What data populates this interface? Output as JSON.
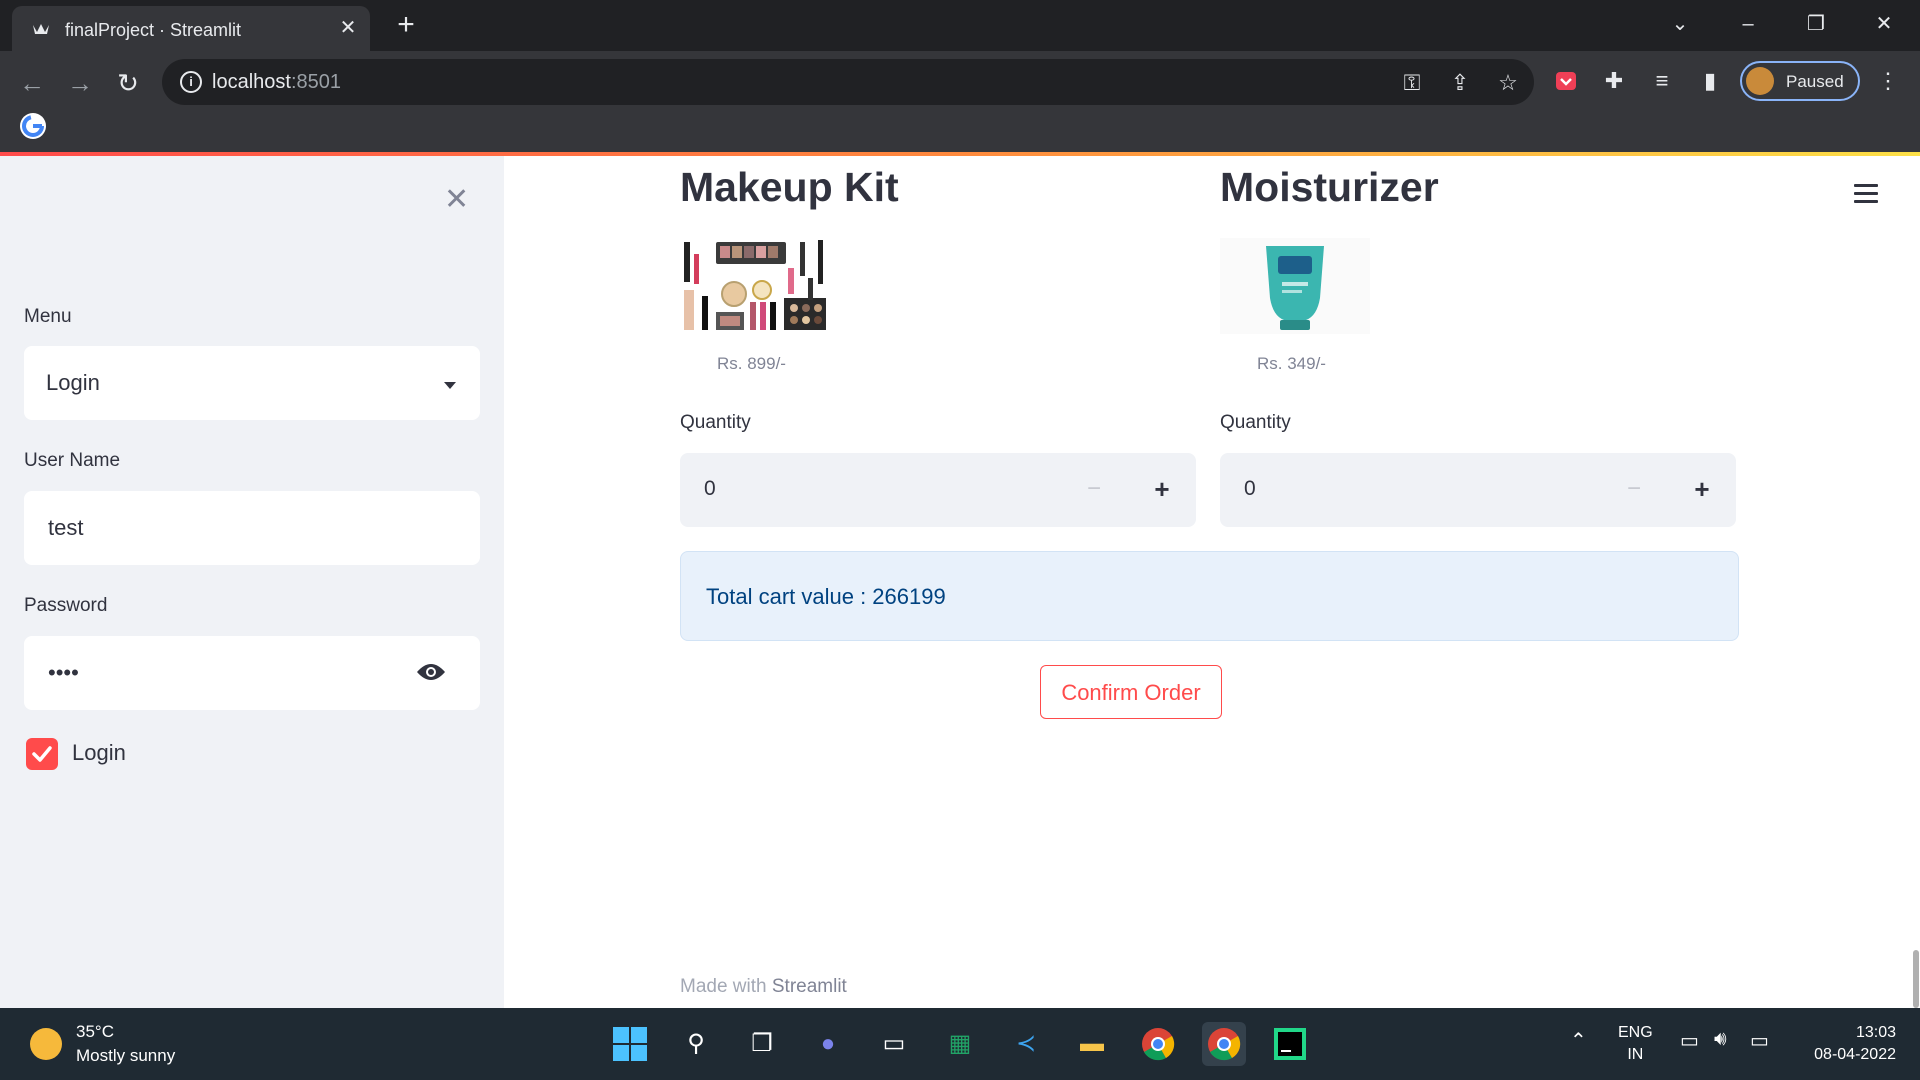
{
  "browser": {
    "tab_title": "finalProject · Streamlit",
    "url_host": "localhost",
    "url_port": ":8501",
    "profile_status": "Paused"
  },
  "sidebar": {
    "menu_label": "Menu",
    "menu_value": "Login",
    "username_label": "User Name",
    "username_value": "test",
    "password_label": "Password",
    "password_value": "••••",
    "login_checkbox_label": "Login",
    "login_checked": true
  },
  "products": [
    {
      "name": "Makeup Kit",
      "price": "Rs. 899/-",
      "quantity_label": "Quantity",
      "quantity": "0"
    },
    {
      "name": "Moisturizer",
      "price": "Rs. 349/-",
      "quantity_label": "Quantity",
      "quantity": "0"
    }
  ],
  "cart": {
    "total_text": "Total cart value : 266199"
  },
  "confirm_button": "Confirm Order",
  "footer": {
    "prefix": "Made with ",
    "brand": "Streamlit"
  },
  "taskbar": {
    "temperature": "35°C",
    "weather": "Mostly sunny",
    "lang_top": "ENG",
    "lang_bottom": "IN",
    "time": "13:03",
    "date": "08-04-2022"
  },
  "colors": {
    "accent": "#ff4b4b",
    "sidebar_bg": "#f0f2f6",
    "info_bg": "#e8f1fb",
    "info_text": "#004280"
  }
}
